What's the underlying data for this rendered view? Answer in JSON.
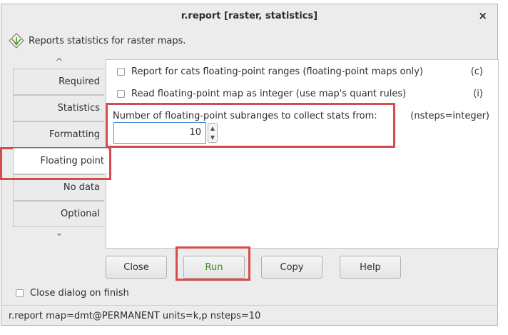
{
  "window": {
    "title": "r.report [raster, statistics]",
    "close_glyph": "×"
  },
  "header": {
    "description": "Reports statistics for raster maps.",
    "icon": "grass-module-icon"
  },
  "tabs": {
    "scroll_up_glyph": "^",
    "scroll_down_glyph": "⌄",
    "items": [
      {
        "label": "Required"
      },
      {
        "label": "Statistics"
      },
      {
        "label": "Formatting"
      },
      {
        "label": "Floating point"
      },
      {
        "label": "No data"
      },
      {
        "label": "Optional"
      }
    ],
    "active": "Floating point"
  },
  "panel": {
    "option_c": {
      "label": "Report for cats floating-point ranges (floating-point maps only)",
      "flag": "(c)",
      "checked": false
    },
    "option_i": {
      "label": "Read floating-point map as integer (use map's quant rules)",
      "flag": "(i)",
      "checked": false
    },
    "nsteps": {
      "label": "Number of floating-point subranges to collect stats from:",
      "key": "(nsteps=integer)",
      "value": "10"
    }
  },
  "buttons": {
    "close": "Close",
    "run": "Run",
    "copy": "Copy",
    "help": "Help"
  },
  "close_on_finish": {
    "label": "Close dialog on finish",
    "checked": false
  },
  "status": {
    "command": "r.report map=dmt@PERMANENT units=k,p nsteps=10"
  },
  "colors": {
    "highlight": "#d64c4c",
    "run_text": "#3a8a22",
    "focus": "#4a90d9"
  }
}
